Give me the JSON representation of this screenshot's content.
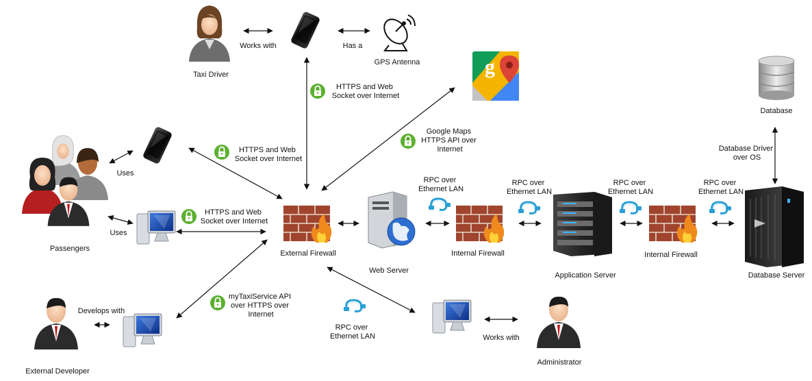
{
  "nodes": {
    "taxi_driver": "Taxi Driver",
    "gps_antenna": "GPS Antenna",
    "database": "Database",
    "passengers": "Passengers",
    "external_firewall": "External Firewall",
    "web_server": "Web Server",
    "internal_firewall_1": "Internal Firewall",
    "application_server": "Application Server",
    "internal_firewall_2": "Internal Firewall",
    "database_server": "Database Server",
    "external_developer": "External Developer",
    "administrator": "Administrator"
  },
  "edges": {
    "works_with_driver": "Works with",
    "has_a": "Has a",
    "uses_phone": "Uses",
    "uses_pc": "Uses",
    "develops_with": "Develops with",
    "works_with_admin": "Works with",
    "driver_https": [
      "HTTPS and Web",
      "Socket over Internet"
    ],
    "passenger_phone_https": [
      "HTTPS and Web",
      "Socket over Internet"
    ],
    "passenger_pc_https": [
      "HTTPS and Web",
      "Socket over Internet"
    ],
    "google_maps_api": [
      "Google Maps",
      "HTTPS API over",
      "Internet"
    ],
    "rpc_web_internal": [
      "RPC over",
      "Ethernet LAN"
    ],
    "rpc_internal_app": [
      "RPC over",
      "Ethernet LAN"
    ],
    "rpc_app_internal": [
      "RPC over",
      "Ethernet LAN"
    ],
    "rpc_internal_db": [
      "RPC over",
      "Ethernet LAN"
    ],
    "rpc_admin": [
      "RPC over",
      "Ethernet LAN"
    ],
    "db_driver": [
      "Database Driver",
      "over OS"
    ],
    "mytaxi_api": [
      "myTaxiService API",
      "over HTTPS over",
      "Internet"
    ]
  },
  "colors": {
    "lock_badge": "#5cb031",
    "firewall_brick": "#a0442e",
    "monitor_screen": "#1e4fb8",
    "google_green": "#109d58",
    "google_red": "#db4437",
    "google_yellow": "#f4b400",
    "google_blue": "#4285f4"
  }
}
